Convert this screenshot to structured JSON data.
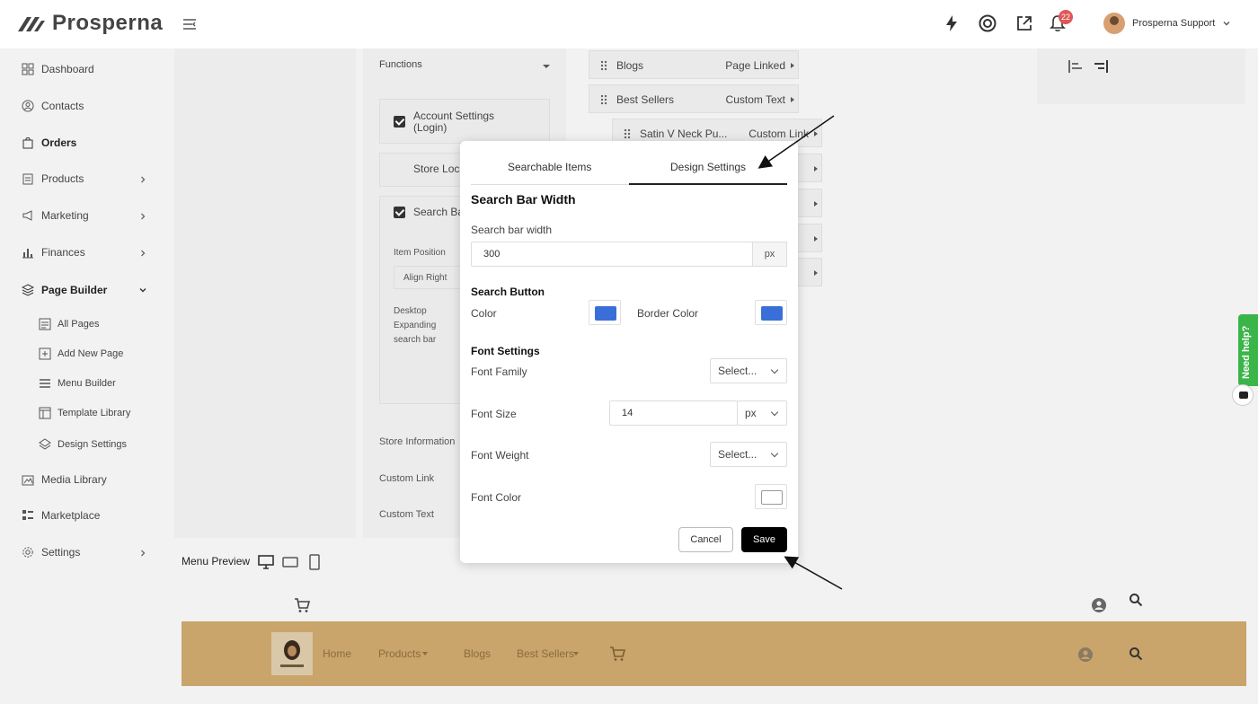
{
  "app": {
    "brand": "Prosperna",
    "notification_count": "22",
    "user_name": "Prosperna Support"
  },
  "sidebar": {
    "items": [
      {
        "label": "Dashboard"
      },
      {
        "label": "Contacts"
      },
      {
        "label": "Orders"
      },
      {
        "label": "Products"
      },
      {
        "label": "Marketing"
      },
      {
        "label": "Finances"
      },
      {
        "label": "Page Builder"
      },
      {
        "label": "Media Library"
      },
      {
        "label": "Marketplace"
      },
      {
        "label": "Settings"
      }
    ],
    "page_builder_sub": [
      {
        "label": "All Pages"
      },
      {
        "label": "Add New Page"
      },
      {
        "label": "Menu Builder"
      },
      {
        "label": "Template Library"
      },
      {
        "label": "Design Settings"
      }
    ]
  },
  "builder": {
    "functions_label": "Functions",
    "account_settings": "Account Settings",
    "account_settings_sub": "(Login)",
    "store_locator": "Store Loca",
    "search_bar": "Search Ba",
    "item_position_label": "Item Position",
    "item_position_value": "Align Right",
    "desktop_expanding_1": "Desktop",
    "desktop_expanding_2": "Expanding",
    "desktop_expanding_3": "search bar",
    "store_information": "Store Information",
    "custom_link": "Custom Link",
    "custom_text": "Custom Text"
  },
  "menu_items": [
    {
      "name": "Blogs",
      "type": "Page Linked"
    },
    {
      "name": "Best Sellers",
      "type": "Custom Text"
    },
    {
      "name": "Satin V Neck Pu...",
      "type": "Custom Link"
    }
  ],
  "preview": {
    "label": "Menu Preview",
    "links": [
      "Home",
      "Products",
      "Blogs",
      "Best Sellers"
    ]
  },
  "help": {
    "label": "Need help?"
  },
  "modal": {
    "tabs": [
      {
        "label": "Searchable Items"
      },
      {
        "label": "Design Settings"
      }
    ],
    "search_bar_width_heading": "Search Bar Width",
    "search_bar_width_label": "Search bar width",
    "search_bar_width_value": "300",
    "search_bar_width_unit": "px",
    "search_button_heading": "Search Button",
    "color_label": "Color",
    "border_color_label": "Border Color",
    "font_settings_heading": "Font Settings",
    "font_family_label": "Font Family",
    "font_family_value": "Select...",
    "font_size_label": "Font Size",
    "font_size_value": "14",
    "font_size_unit": "px",
    "font_weight_label": "Font Weight",
    "font_weight_value": "Select...",
    "font_color_label": "Font Color",
    "cancel_label": "Cancel",
    "save_label": "Save"
  },
  "colors": {
    "button_color": "#3a6fd8",
    "border_color": "#3a6fd8",
    "font_color": "#ffffff",
    "help_tab": "#3bb54a",
    "preview_bar": "#c9a46b"
  }
}
